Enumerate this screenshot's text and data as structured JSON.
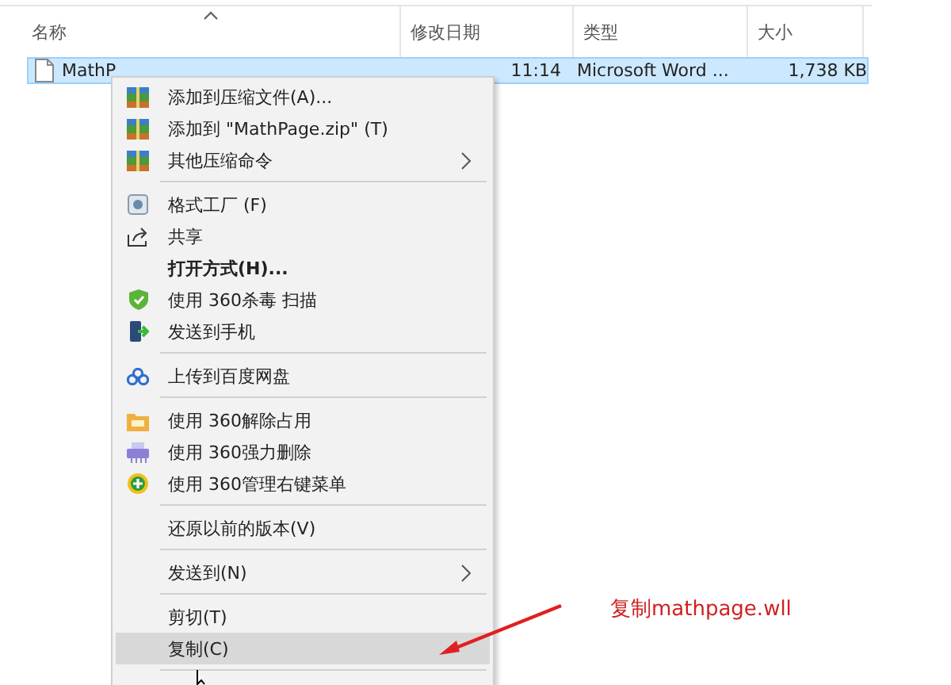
{
  "columns": [
    {
      "label": "名称",
      "sorted": true
    },
    {
      "label": "修改日期",
      "sorted": false
    },
    {
      "label": "类型",
      "sorted": false
    },
    {
      "label": "大小",
      "sorted": false
    }
  ],
  "files": [
    {
      "name": "MathP",
      "modified": "11:14",
      "type": "Microsoft Word ...",
      "size": "1,738 KB",
      "selected": true
    }
  ],
  "context_menu": {
    "items": [
      {
        "kind": "item",
        "label": "添加到压缩文件(A)...",
        "bold": false,
        "submenu": false,
        "selected": false
      },
      {
        "kind": "item",
        "label": "添加到 \"MathPage.zip\" (T)",
        "bold": false,
        "submenu": false,
        "selected": false
      },
      {
        "kind": "item",
        "label": "其他压缩命令",
        "bold": false,
        "submenu": true,
        "selected": false
      },
      {
        "kind": "separator"
      },
      {
        "kind": "item",
        "label": "格式工厂 (F)",
        "bold": false,
        "submenu": false,
        "selected": false
      },
      {
        "kind": "item",
        "label": "共享",
        "bold": false,
        "submenu": false,
        "selected": false
      },
      {
        "kind": "item",
        "label": "打开方式(H)...",
        "bold": true,
        "submenu": false,
        "selected": false
      },
      {
        "kind": "item",
        "label": "使用 360杀毒 扫描",
        "bold": false,
        "submenu": false,
        "selected": false
      },
      {
        "kind": "item",
        "label": "发送到手机",
        "bold": false,
        "submenu": false,
        "selected": false
      },
      {
        "kind": "separator"
      },
      {
        "kind": "item",
        "label": "上传到百度网盘",
        "bold": false,
        "submenu": false,
        "selected": false
      },
      {
        "kind": "separator"
      },
      {
        "kind": "item",
        "label": "使用 360解除占用",
        "bold": false,
        "submenu": false,
        "selected": false
      },
      {
        "kind": "item",
        "label": "使用 360强力删除",
        "bold": false,
        "submenu": false,
        "selected": false
      },
      {
        "kind": "item",
        "label": "使用 360管理右键菜单",
        "bold": false,
        "submenu": false,
        "selected": false
      },
      {
        "kind": "separator"
      },
      {
        "kind": "item",
        "label": "还原以前的版本(V)",
        "bold": false,
        "submenu": false,
        "selected": false
      },
      {
        "kind": "separator"
      },
      {
        "kind": "item",
        "label": "发送到(N)",
        "bold": false,
        "submenu": true,
        "selected": false
      },
      {
        "kind": "separator"
      },
      {
        "kind": "item",
        "label": "剪切(T)",
        "bold": false,
        "submenu": false,
        "selected": false
      },
      {
        "kind": "item",
        "label": "复制(C)",
        "bold": false,
        "submenu": false,
        "selected": true
      },
      {
        "kind": "separator"
      }
    ]
  },
  "annotation": {
    "text": "复制mathpage.wll"
  }
}
